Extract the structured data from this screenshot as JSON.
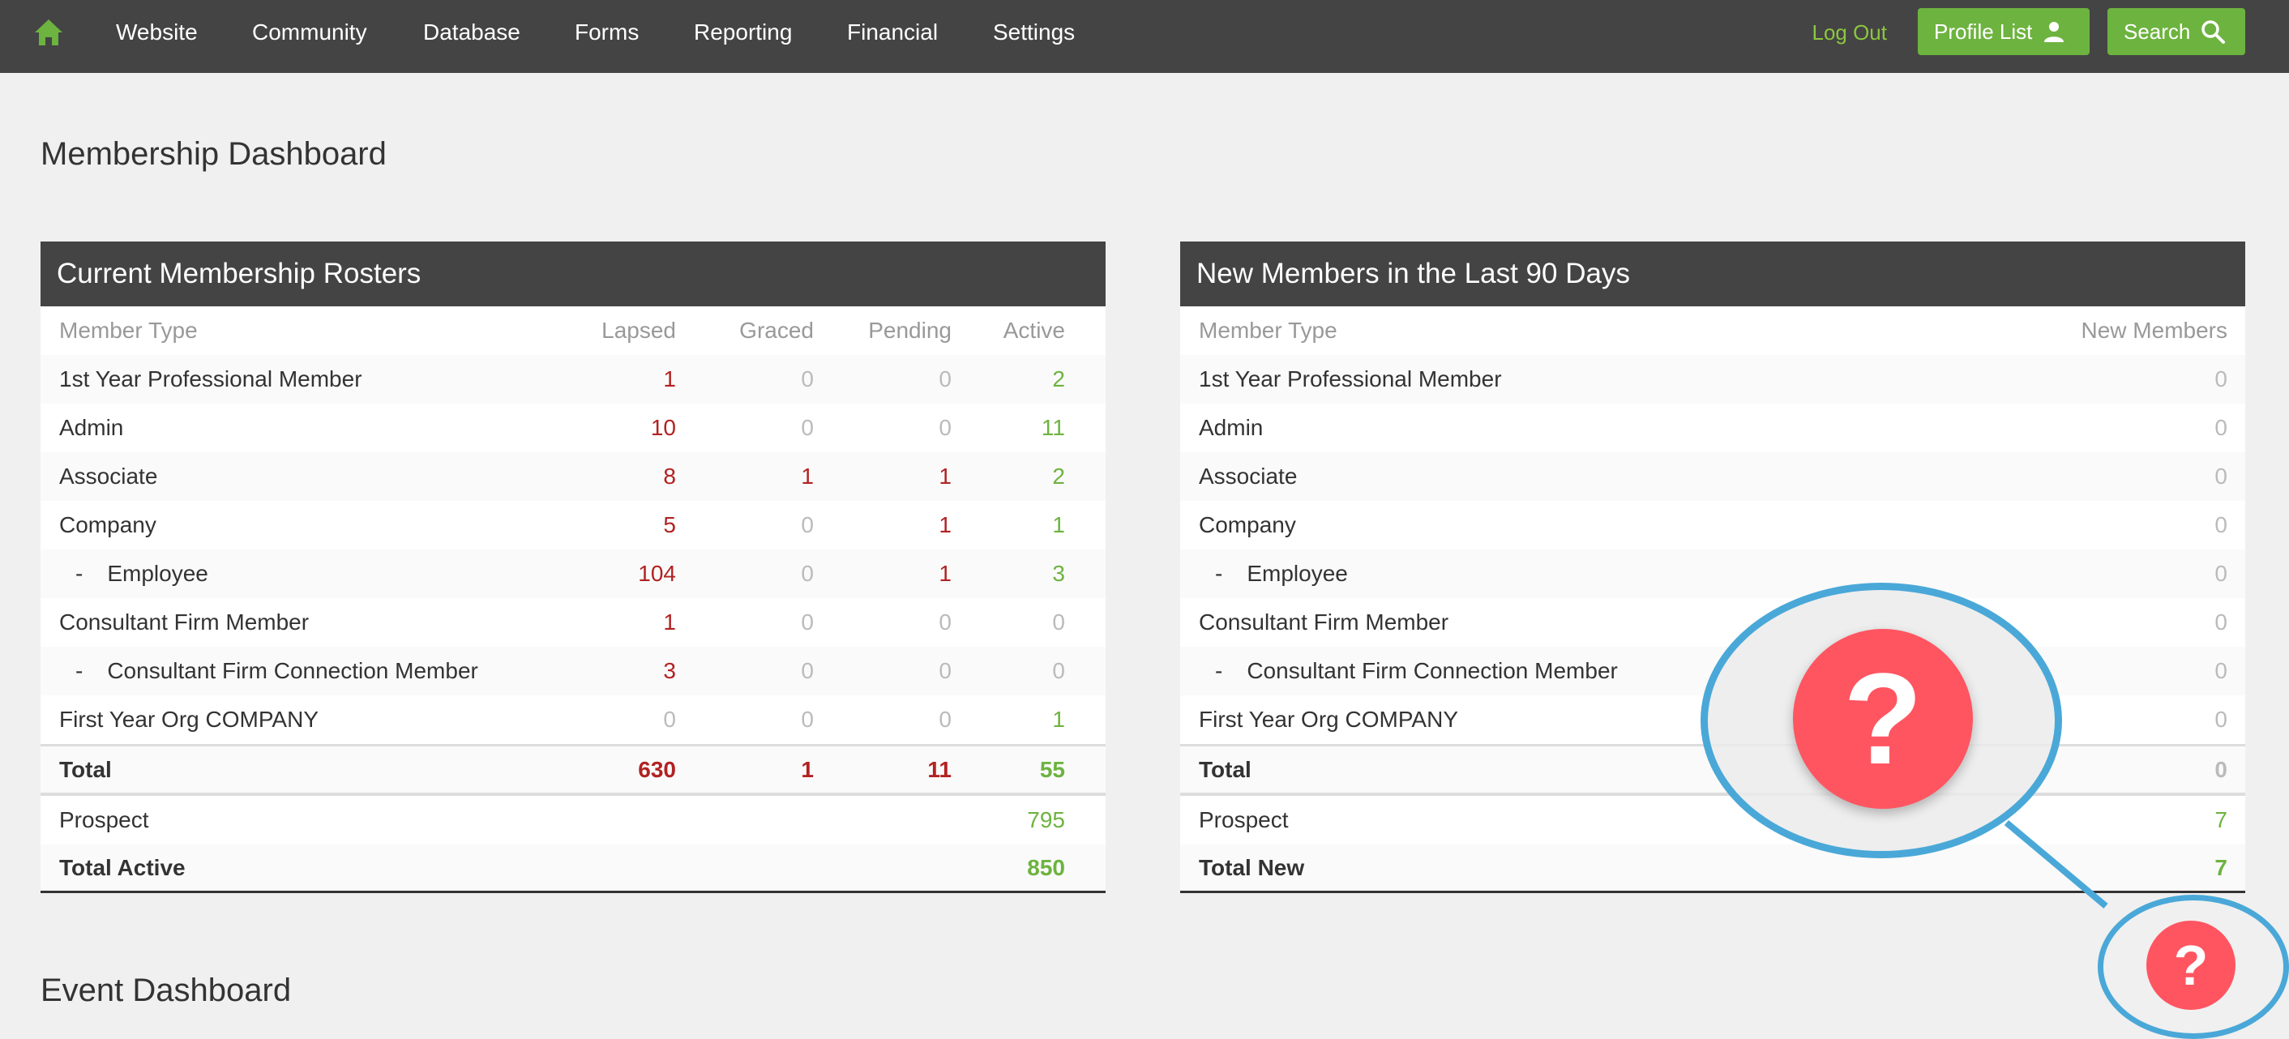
{
  "nav": {
    "links": [
      "Website",
      "Community",
      "Database",
      "Forms",
      "Reporting",
      "Financial",
      "Settings"
    ],
    "logout": "Log Out",
    "profile_list": "Profile List",
    "search": "Search"
  },
  "page_title": "Membership Dashboard",
  "event_title": "Event Dashboard",
  "rosters": {
    "title": "Current Membership Rosters",
    "headers": [
      "Member Type",
      "Lapsed",
      "Graced",
      "Pending",
      "Active"
    ],
    "rows": [
      {
        "name": "1st Year Professional Member",
        "sub": false,
        "lapsed": "1",
        "graced": "0",
        "pending": "0",
        "active": "2"
      },
      {
        "name": "Admin",
        "sub": false,
        "lapsed": "10",
        "graced": "0",
        "pending": "0",
        "active": "11"
      },
      {
        "name": "Associate",
        "sub": false,
        "lapsed": "8",
        "graced": "1",
        "pending": "1",
        "active": "2"
      },
      {
        "name": "Company",
        "sub": false,
        "lapsed": "5",
        "graced": "0",
        "pending": "1",
        "active": "1"
      },
      {
        "name": "Employee",
        "sub": true,
        "lapsed": "104",
        "graced": "0",
        "pending": "1",
        "active": "3"
      },
      {
        "name": "Consultant Firm Member",
        "sub": false,
        "lapsed": "1",
        "graced": "0",
        "pending": "0",
        "active": "0"
      },
      {
        "name": "Consultant Firm Connection Member",
        "sub": true,
        "lapsed": "3",
        "graced": "0",
        "pending": "0",
        "active": "0"
      },
      {
        "name": "First Year Org COMPANY",
        "sub": false,
        "lapsed": "0",
        "graced": "0",
        "pending": "0",
        "active": "1"
      }
    ],
    "total": {
      "label": "Total",
      "lapsed": "630",
      "graced": "1",
      "pending": "11",
      "active": "55"
    },
    "prospect": {
      "label": "Prospect",
      "value": "795"
    },
    "total_active": {
      "label": "Total Active",
      "value": "850"
    }
  },
  "new_members": {
    "title": "New Members in the Last 90 Days",
    "headers": [
      "Member Type",
      "New Members"
    ],
    "rows": [
      {
        "name": "1st Year Professional Member",
        "sub": false,
        "value": "0"
      },
      {
        "name": "Admin",
        "sub": false,
        "value": "0"
      },
      {
        "name": "Associate",
        "sub": false,
        "value": "0"
      },
      {
        "name": "Company",
        "sub": false,
        "value": "0"
      },
      {
        "name": "Employee",
        "sub": true,
        "value": "0"
      },
      {
        "name": "Consultant Firm Member",
        "sub": false,
        "value": "0"
      },
      {
        "name": "Consultant Firm Connection Member",
        "sub": true,
        "value": "0"
      },
      {
        "name": "First Year Org COMPANY",
        "sub": false,
        "value": "0"
      }
    ],
    "total": {
      "label": "Total",
      "value": "0"
    },
    "prospect": {
      "label": "Prospect",
      "value": "7"
    },
    "total_new": {
      "label": "Total New",
      "value": "7"
    }
  },
  "help": {
    "glyph": "?"
  },
  "colors": {
    "nav_bg": "#444444",
    "accent_green": "#6db33f",
    "lapsed_red": "#b22222",
    "help_red": "#ff5561",
    "callout_blue": "#4aa8d8"
  }
}
